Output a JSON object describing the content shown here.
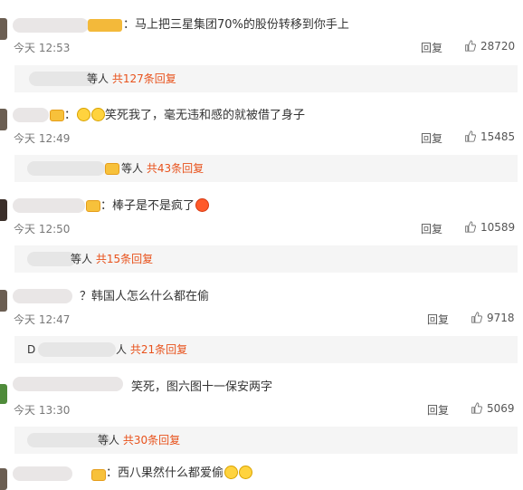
{
  "like_label": "回复",
  "comments": [
    {
      "text": "：马上把三星集团70%的股份转移到你手上",
      "time": "今天 12:53",
      "likes": "28720",
      "thread_prefix": "等人",
      "thread_count": "共127条回复"
    },
    {
      "text": "：",
      "text_after": "笑死我了，毫无违和感的就被借了身子",
      "time": "今天 12:49",
      "likes": "15485",
      "thread_prefix": "等人",
      "thread_count": "共43条回复"
    },
    {
      "text": "：棒子是不是疯了",
      "time": "今天 12:50",
      "likes": "10589",
      "thread_prefix": "等人",
      "thread_count": "共15条回复"
    },
    {
      "text": "？韩国人怎么什么都在偷",
      "time": "今天 12:47",
      "likes": "9718",
      "thread_prefix": "D",
      "thread_prefix2": "人",
      "thread_count": "共21条回复"
    },
    {
      "text": "笑死，图六图十一保安两字",
      "time": "今天 13:30",
      "likes": "5069",
      "thread_prefix": "等人",
      "thread_count": "共30条回复"
    },
    {
      "text": "：西八果然什么都爱偷"
    }
  ],
  "colors": {
    "link": "#e8521c",
    "badge": "#f3b93a",
    "bar": "#f5f5f5"
  },
  "icons": {
    "like": "thumb-up-icon",
    "badge": "vip-badge-icon",
    "laugh": "laugh-emoji-icon",
    "angry": "angry-emoji-icon"
  }
}
